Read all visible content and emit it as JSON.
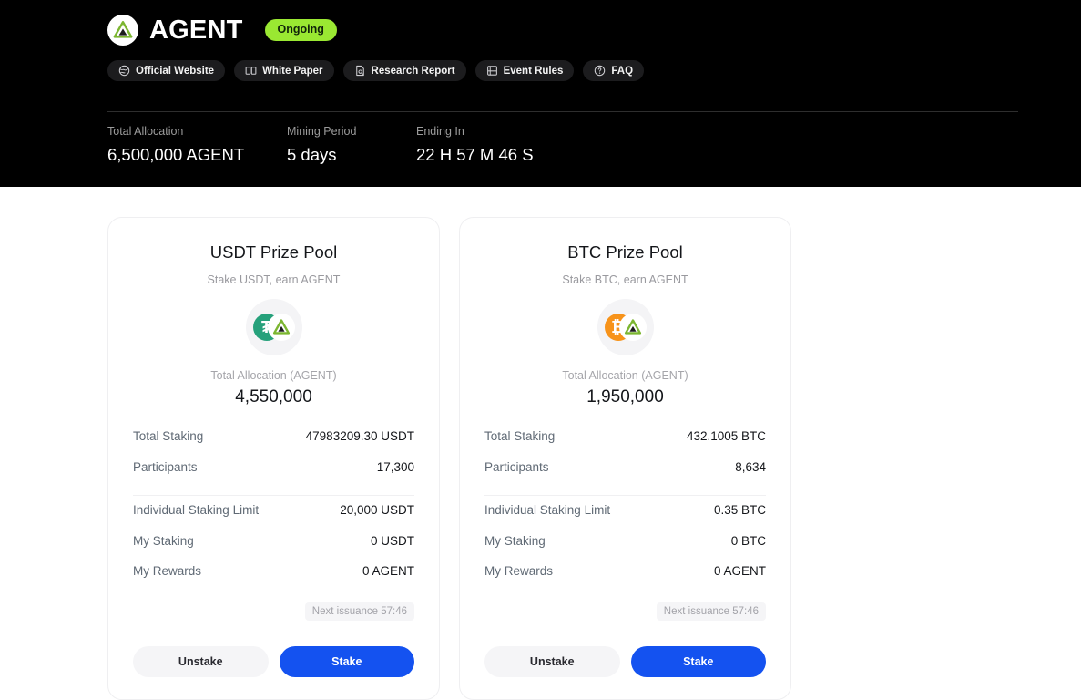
{
  "header": {
    "logo_icon": "agent-pyramid-logo",
    "project_name": "AGENT",
    "status_badge": "Ongoing",
    "accent_green": "#9ae832",
    "links": [
      {
        "label": "Official Website",
        "icon": "globe-icon"
      },
      {
        "label": "White Paper",
        "icon": "book-open-icon"
      },
      {
        "label": "Research Report",
        "icon": "document-search-icon"
      },
      {
        "label": "Event Rules",
        "icon": "book-icon"
      },
      {
        "label": "FAQ",
        "icon": "question-circle-icon"
      }
    ],
    "stats": [
      {
        "label": "Total Allocation",
        "value": "6,500,000 AGENT"
      },
      {
        "label": "Mining Period",
        "value": "5 days"
      },
      {
        "label": "Ending In",
        "value": "22 H 57 M 46 S"
      }
    ]
  },
  "pools": [
    {
      "title": "USDT Prize Pool",
      "subtitle": "Stake USDT, earn AGENT",
      "coin_symbol": "₮",
      "coin_color": "#26a17b",
      "coin_icon": "usdt-token-icon",
      "pair_icon": "agent-token-icon",
      "allocation_label": "Total Allocation (AGENT)",
      "allocation_value": "4,550,000",
      "rows_top": [
        {
          "label": "Total Staking",
          "value": "47983209.30 USDT"
        },
        {
          "label": "Participants",
          "value": "17,300"
        }
      ],
      "rows_bottom": [
        {
          "label": "Individual Staking Limit",
          "value": "20,000 USDT"
        },
        {
          "label": "My Staking",
          "value": "0 USDT"
        },
        {
          "label": "My Rewards",
          "value": "0 AGENT"
        }
      ],
      "issuance": "Next issuance 57:46",
      "unstake_label": "Unstake",
      "stake_label": "Stake"
    },
    {
      "title": "BTC Prize Pool",
      "subtitle": "Stake BTC, earn AGENT",
      "coin_symbol": "₿",
      "coin_color": "#f7931a",
      "coin_icon": "btc-token-icon",
      "pair_icon": "agent-token-icon",
      "allocation_label": "Total Allocation (AGENT)",
      "allocation_value": "1,950,000",
      "rows_top": [
        {
          "label": "Total Staking",
          "value": "432.1005 BTC"
        },
        {
          "label": "Participants",
          "value": "8,634"
        }
      ],
      "rows_bottom": [
        {
          "label": "Individual Staking Limit",
          "value": "0.35 BTC"
        },
        {
          "label": "My Staking",
          "value": "0 BTC"
        },
        {
          "label": "My Rewards",
          "value": "0 AGENT"
        }
      ],
      "issuance": "Next issuance 57:46",
      "unstake_label": "Unstake",
      "stake_label": "Stake"
    }
  ]
}
